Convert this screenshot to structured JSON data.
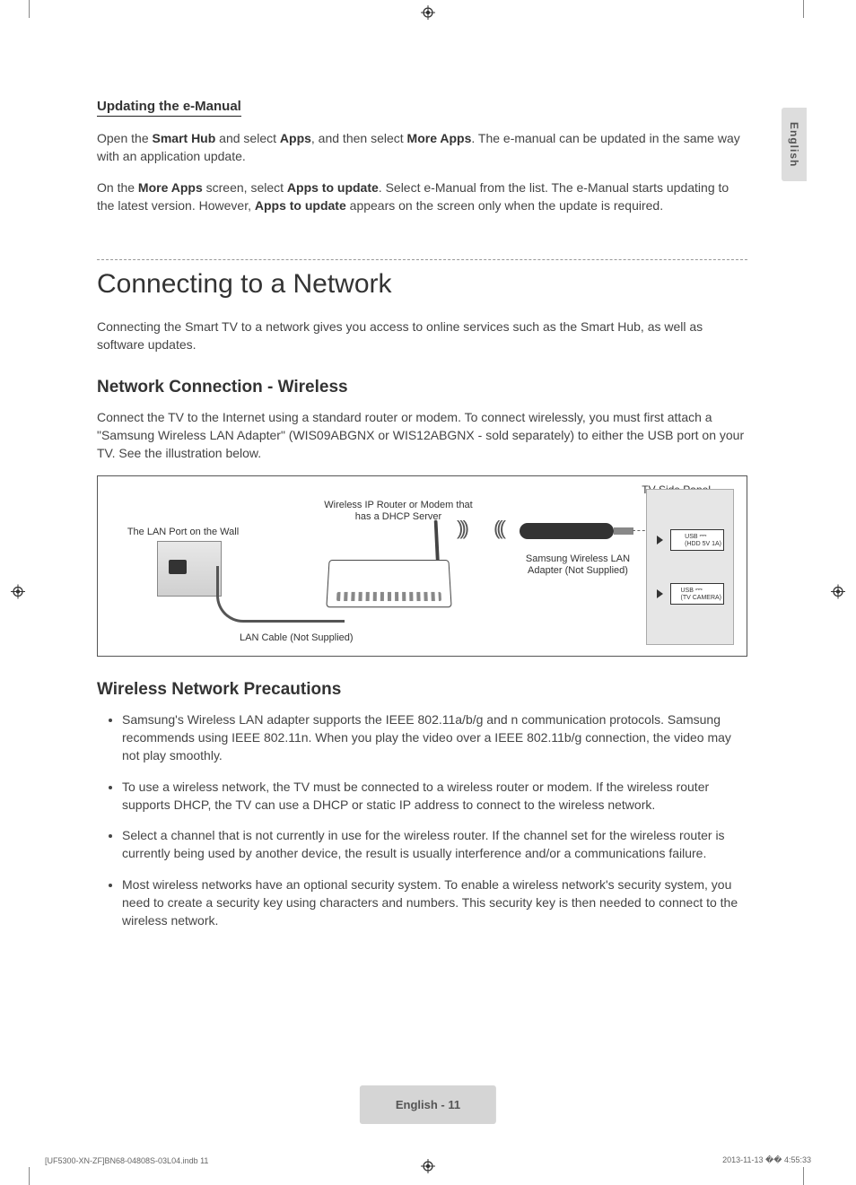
{
  "lang_tab": "English",
  "updating": {
    "heading": "Updating the e-Manual",
    "p1_a": "Open the ",
    "p1_b": "Smart Hub",
    "p1_c": " and select ",
    "p1_d": "Apps",
    "p1_e": ", and then select ",
    "p1_f": "More Apps",
    "p1_g": ". The e-manual can be updated in the same way with an application update.",
    "p2_a": "On the ",
    "p2_b": "More Apps",
    "p2_c": " screen, select ",
    "p2_d": "Apps to update",
    "p2_e": ". Select e-Manual from the list. The e-Manual starts updating to the latest version. However, ",
    "p2_f": "Apps to update",
    "p2_g": " appears on the screen only when the update is required."
  },
  "section_title": "Connecting to a Network",
  "section_intro": "Connecting the Smart TV to a network gives you access to online services such as the Smart Hub, as well as software updates.",
  "wireless": {
    "heading": "Network Connection - Wireless",
    "desc": "Connect the TV to the Internet using a standard router or modem. To connect wirelessly, you must first attach a \"Samsung Wireless LAN Adapter\" (WIS09ABGNX or WIS12ABGNX - sold separately) to either the USB port on your TV. See the illustration below."
  },
  "figure": {
    "tv_panel": "TV Side Panel",
    "wall": "The LAN Port on the Wall",
    "lan_cable": "LAN Cable (Not Supplied)",
    "router": "Wireless IP Router or Modem that has a DHCP Server",
    "adapter": "Samsung Wireless LAN Adapter (Not Supplied)",
    "usb1_top": "USB",
    "usb1_bot": "(HDD 5V 1A)",
    "usb2_top": "USB",
    "usb2_bot": "(TV CAMERA)"
  },
  "precautions": {
    "heading": "Wireless Network Precautions",
    "items": [
      "Samsung's Wireless LAN adapter supports the IEEE 802.11a/b/g and n communication protocols. Samsung recommends using IEEE 802.11n. When you play the video over a IEEE 802.11b/g connection, the video may not play smoothly.",
      "To use a wireless network, the TV must be connected to a wireless router or modem. If the wireless router supports DHCP, the TV can use a DHCP or static IP address to connect to the wireless network.",
      "Select a channel that is not currently in use for the wireless router. If the channel set for the wireless router is currently being used by another device, the result is usually interference and/or a communications failure.",
      "Most wireless networks have an optional security system. To enable a wireless network's security system, you need to create a security key using characters and numbers. This security key is then needed to connect to the wireless network."
    ]
  },
  "footer": {
    "page": "English - 11",
    "docref": "[UF5300-XN-ZF]BN68-04808S-03L04.indb   11",
    "timestamp": "2013-11-13   �� 4:55:33"
  }
}
